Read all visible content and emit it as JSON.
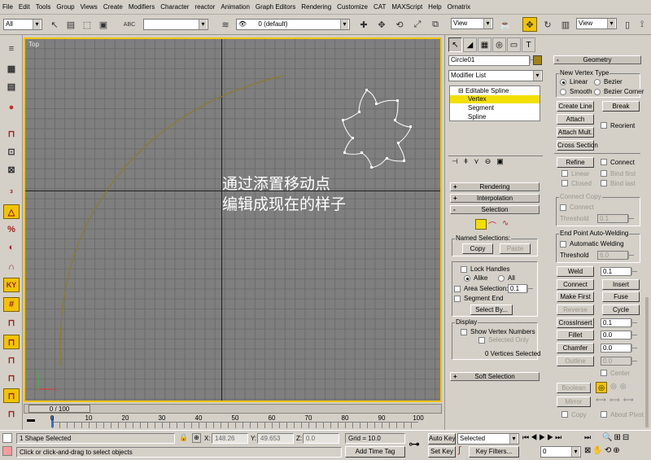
{
  "menu": [
    "File",
    "Edit",
    "Tools",
    "Group",
    "Views",
    "Create",
    "Modifiers",
    "Character",
    "reactor",
    "Animation",
    "Graph Editors",
    "Rendering",
    "Customize",
    "CAT",
    "MAXScript",
    "Help",
    "Ornatrix"
  ],
  "toolbar": {
    "selection_filter": "All",
    "named_selection": "",
    "layer": "0 (default)",
    "ref_coord_1": "View",
    "ref_coord_2": "View"
  },
  "viewport": {
    "label": "Top",
    "overlay_line1": "通过添置移动点",
    "overlay_line2": "编辑成现在的样子",
    "border_color": "#f2c400",
    "curve_color": "#8b7a2a"
  },
  "timeline": {
    "slider_label": "0 / 100",
    "ticks": [
      "0",
      "10",
      "20",
      "30",
      "40",
      "50",
      "60",
      "70",
      "80",
      "90",
      "100"
    ]
  },
  "status": {
    "selected": "1 Shape Selected",
    "prompt": "Click or click-and-drag to select objects",
    "x_label": "X:",
    "x_value": "148.26",
    "y_label": "Y:",
    "y_value": "49.653",
    "z_label": "Z:",
    "z_value": "0.0",
    "grid": "Grid = 10.0",
    "add_time_tag": "Add Time Tag",
    "auto_key": "Auto Key",
    "set_key": "Set Key",
    "key_mode": "Selected",
    "key_filters": "Key Filters...",
    "frame": "0"
  },
  "command_panel": {
    "object_name": "Circle01",
    "modifier_list": "Modifier List",
    "stack": [
      "Editable Spline",
      "Vertex",
      "Segment",
      "Spline"
    ],
    "rollouts": {
      "rendering": "Rendering",
      "interpolation": "Interpolation",
      "selection": "Selection",
      "soft_selection": "Soft Selection",
      "geometry": "Geometry"
    },
    "selection": {
      "named_selections": "Named Selections:",
      "copy": "Copy",
      "paste": "Paste",
      "lock_handles": "Lock Handles",
      "alike": "Alike",
      "all": "All",
      "area_selection": "Area Selection:",
      "area_value": "0.1",
      "segment_end": "Segment End",
      "select_by": "Select By...",
      "display": "Display",
      "show_vertex_numbers": "Show Vertex Numbers",
      "selected_only": "Selected Only",
      "vertices_selected": "0 Vertices Selected"
    },
    "geometry": {
      "new_vertex_type": "New Vertex Type",
      "linear": "Linear",
      "bezier": "Bezier",
      "smooth": "Smooth",
      "bezier_corner": "Bezier Corner",
      "create_line": "Create Line",
      "break": "Break",
      "attach": "Attach",
      "reorient": "Reorient",
      "attach_mult": "Attach Mult.",
      "cross_section": "Cross Section",
      "refine": "Refine",
      "connect": "Connect",
      "linear2": "Linear",
      "bind_first": "Bind first",
      "closed": "Closed",
      "bind_last": "Bind last",
      "connect_copy": "Connect Copy",
      "connect2": "Connect",
      "threshold": "Threshold",
      "threshold_val": "0.1",
      "end_point_welding": "End Point Auto-Welding",
      "automatic_welding": "Automatic Welding",
      "threshold2": "Threshold",
      "threshold2_val": "6.0",
      "weld": "Weld",
      "weld_val": "0.1",
      "connect3": "Connect",
      "insert": "Insert",
      "make_first": "Make First",
      "fuse": "Fuse",
      "reverse": "Reverse",
      "cycle": "Cycle",
      "crossinsert": "CrossInsert",
      "crossinsert_val": "0.1",
      "fillet": "Fillet",
      "fillet_val": "0.0",
      "chamfer": "Chamfer",
      "chamfer_val": "0.0",
      "outline": "Outline",
      "outline_val": "0.0",
      "center": "Center",
      "boolean": "Boolean",
      "mirror": "Mirror",
      "copy": "Copy",
      "about_pivot": "About Pivot"
    }
  }
}
